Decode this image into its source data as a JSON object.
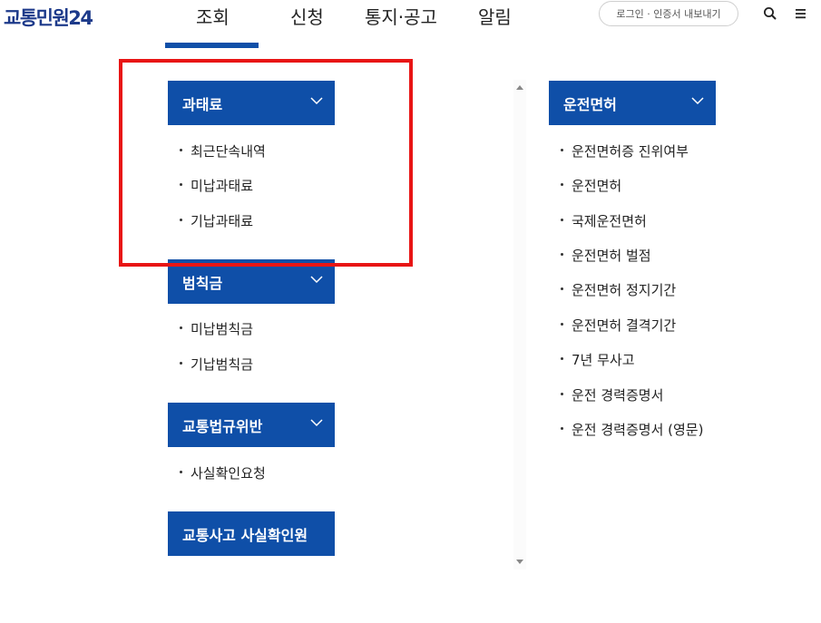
{
  "header": {
    "logo": "교통민원24",
    "tabs": [
      {
        "label": "조회"
      },
      {
        "label": "신청"
      },
      {
        "label": "통지·공고"
      },
      {
        "label": "알림"
      }
    ],
    "login_label": "로그인 · 인증서 내보내기",
    "search_icon": "search-icon",
    "menu_icon": "hamburger-menu-icon"
  },
  "sections": {
    "fine": {
      "title": "과태료",
      "items": [
        "최근단속내역",
        "미납과태료",
        "기납과태료"
      ]
    },
    "penalty": {
      "title": "범칙금",
      "items": [
        "미납범칙금",
        "기납범칙금"
      ]
    },
    "violation": {
      "title": "교통법규위반",
      "items": [
        "사실확인요청"
      ]
    },
    "accident": {
      "title": "교통사고 사실확인원"
    },
    "license": {
      "title": "운전면허",
      "items": [
        "운전면허증 진위여부",
        "운전면허",
        "국제운전면허",
        "운전면허 벌점",
        "운전면허 정지기간",
        "운전면허 결격기간",
        "7년 무사고",
        "운전 경력증명서",
        "운전 경력증명서 (영문)"
      ]
    }
  },
  "colors": {
    "primary": "#0f4fa8",
    "logo": "#1d3a8a",
    "highlight": "#e81515"
  }
}
